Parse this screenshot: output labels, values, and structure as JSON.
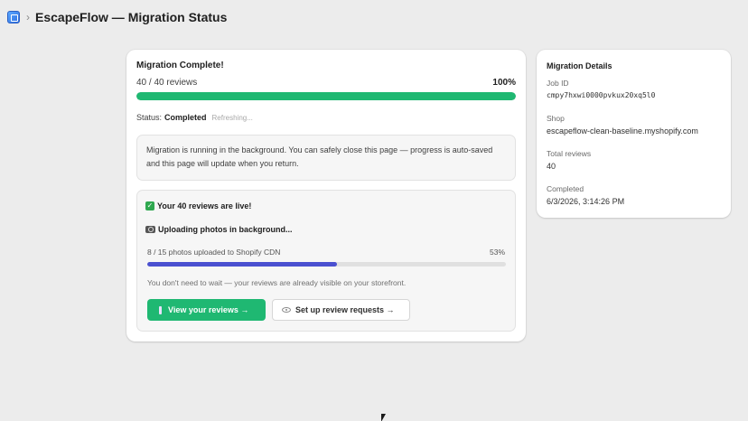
{
  "header": {
    "breadcrumb_separator": "›",
    "title": "EscapeFlow — Migration Status"
  },
  "migration": {
    "title": "Migration Complete!",
    "count_text": "40 / 40 reviews",
    "percent_text": "100%",
    "progress": 1.0,
    "status_label": "Status:",
    "status_value": "Completed",
    "refreshing_text": "Refreshing...",
    "info_text": "Migration is running in the background. You can safely close this page — progress is auto-saved and this page will update when you return."
  },
  "live": {
    "title": "Your 40 reviews are live!",
    "uploading_title": "Uploading photos in background...",
    "photos_text": "8 / 15 photos uploaded to Shopify CDN",
    "photos_percent_text": "53%",
    "photos_progress": 0.53,
    "no_wait_text": "You don't need to wait — your reviews are already visible on your storefront.",
    "view_button": "View your reviews →",
    "setup_button": "Set up review requests →"
  },
  "details": {
    "title": "Migration Details",
    "job_id_label": "Job ID",
    "job_id": "cmpy7hxwi0000pvkux20xq5l0",
    "shop_label": "Shop",
    "shop": "escapeflow-clean-baseline.myshopify.com",
    "total_label": "Total reviews",
    "total": "40",
    "completed_label": "Completed",
    "completed": "6/3/2026, 3:14:26 PM"
  },
  "colors": {
    "accent": "#1fb872",
    "photo_bar": "#4a50d0",
    "background": "#ececec"
  },
  "icons": [
    "app-icon",
    "check-icon",
    "camera-icon",
    "flask-icon",
    "eye-icon"
  ]
}
